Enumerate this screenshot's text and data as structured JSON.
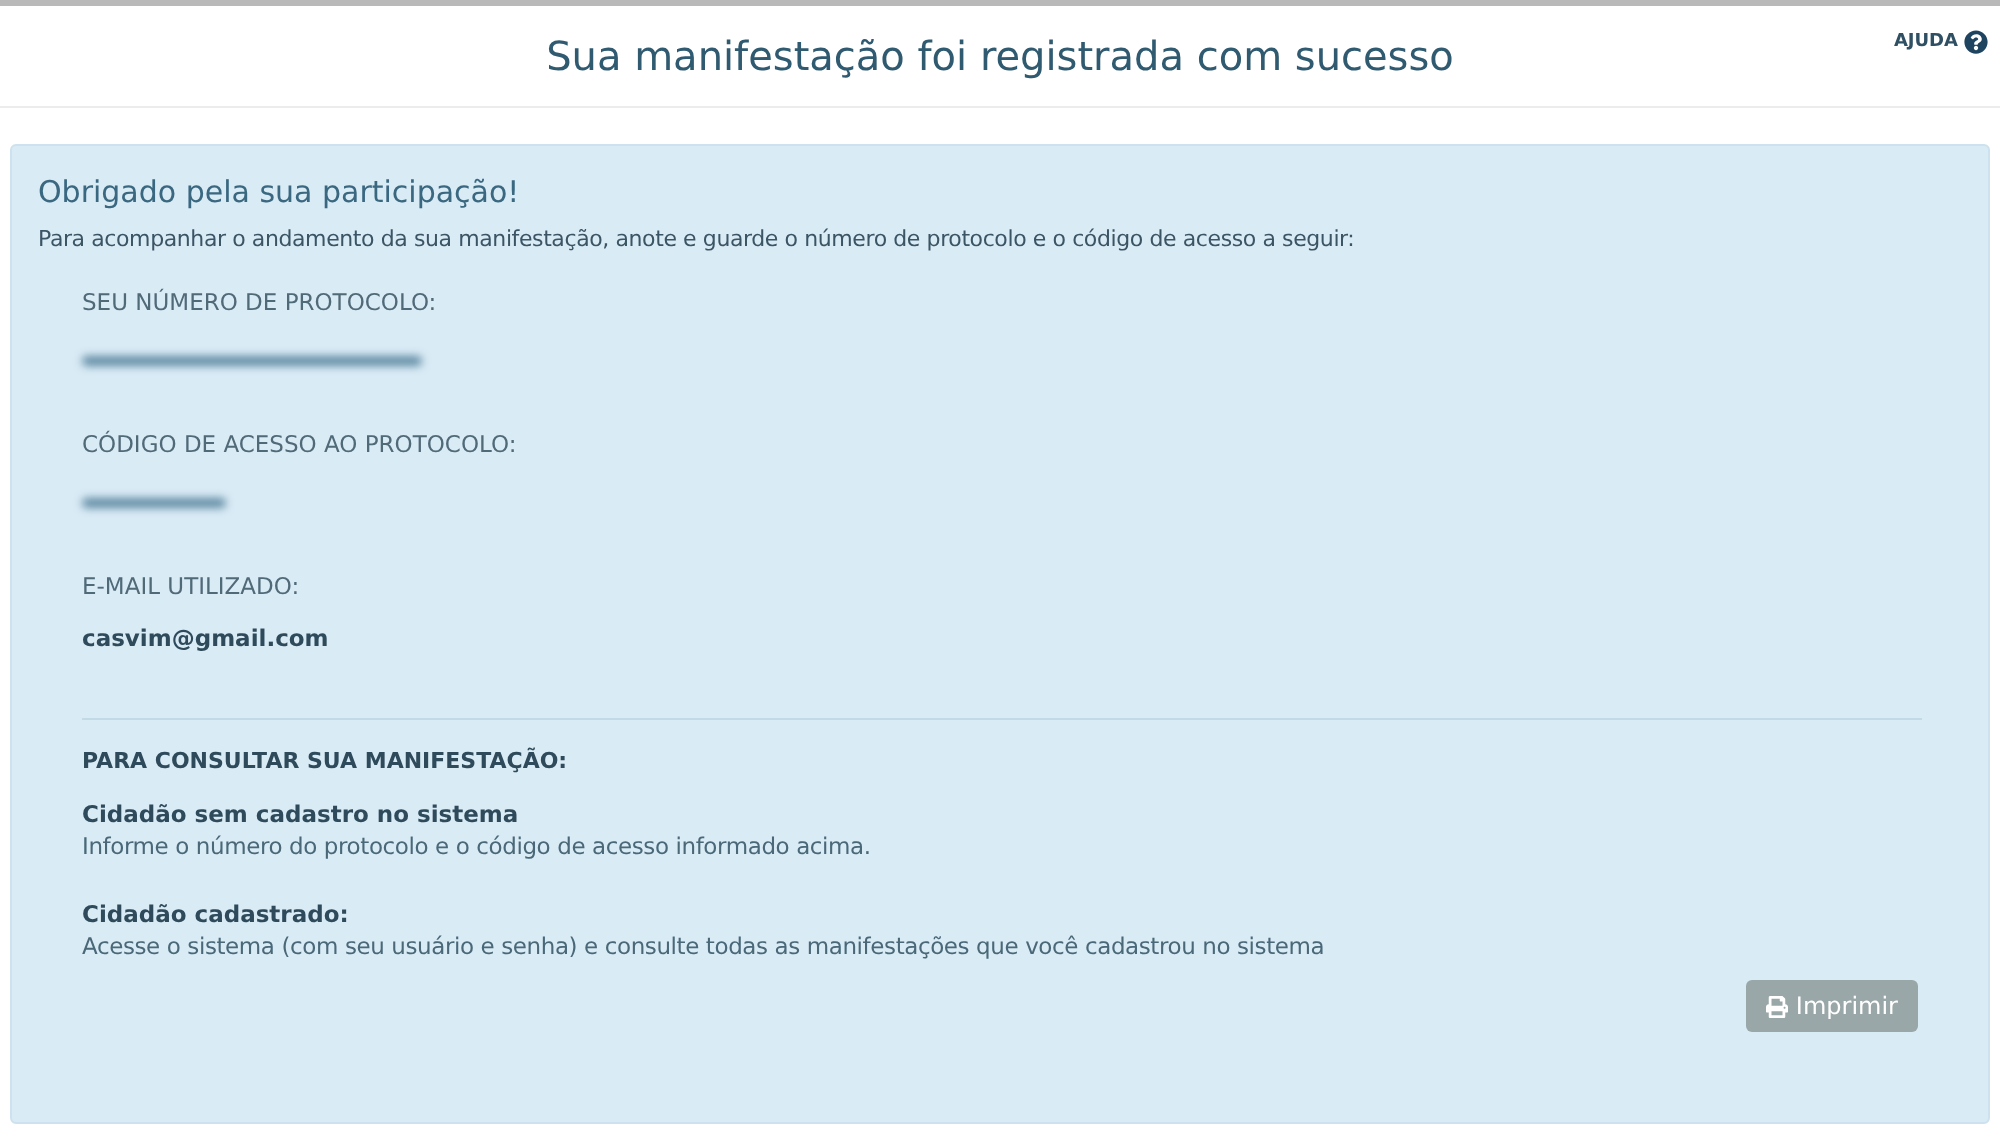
{
  "header": {
    "title": "Sua manifestação foi registrada com sucesso",
    "help_link": "AJUDA"
  },
  "panel": {
    "heading": "Obrigado pela sua participação!",
    "intro": "Para acompanhar o andamento da sua manifestação, anote e guarde o número de protocolo e o código de acesso a seguir:",
    "fields": [
      {
        "label": "SEU NÚMERO DE PROTOCOLO:",
        "kind": "redacted"
      },
      {
        "label": "CÓDIGO DE ACESSO AO PROTOCOLO:",
        "kind": "redacted"
      },
      {
        "label": "E-MAIL UTILIZADO:",
        "kind": "text",
        "value": "casvim@gmail.com"
      }
    ],
    "consult_title": "PARA CONSULTAR SUA MANIFESTAÇÃO:",
    "consult_items": [
      {
        "title": "Cidadão sem cadastro no sistema",
        "text": "Informe o número do protocolo e o código de acesso informado acima."
      },
      {
        "title": "Cidadão cadastrado:",
        "text": "Acesse o sistema (com seu usuário e senha) e consulte todas as manifestações que você cadastrou no sistema"
      }
    ],
    "print_button": {
      "label": "Imprimir",
      "disabled": true
    }
  }
}
